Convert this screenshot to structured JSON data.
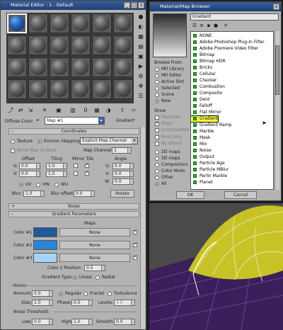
{
  "material_editor": {
    "title": "Material Editor - 1 - Default",
    "diffuse_label": "Diffuse Color:",
    "map_name": "Map #1",
    "map_type": "Gradient",
    "toolbar_zero": "0",
    "coordinates": {
      "header": "Coordinates",
      "texture": "Texture",
      "environ": "Environ",
      "mapping_label": "Mapping:",
      "mapping_value": "Explicit Map Channel",
      "show_map_on_back": "Show Map on Back",
      "map_channel_label": "Map Channel:",
      "map_channel_value": "1",
      "col_offset": "Offset",
      "col_tiling": "Tiling",
      "col_mirror_tile": "Mirror Tile",
      "col_angle": "Angle",
      "u_label": "U:",
      "v_label": "V:",
      "w_label": "W:",
      "u_offset": "0.0",
      "u_tiling": "1.0",
      "u_angle": "0.0",
      "v_offset": "0.0",
      "v_tiling": "1.0",
      "v_angle": "0.0",
      "w_angle": "0.0",
      "uv": "UV",
      "vw": "VW",
      "wu": "WU",
      "blur_label": "Blur:",
      "blur_value": "1.0",
      "blur_offset_label": "Blur offset:",
      "blur_offset_value": "0.0",
      "rotate": "Rotate"
    },
    "noise_header": "Noise",
    "gradient": {
      "header": "Gradient Parameters",
      "maps_label": "Maps",
      "color1_label": "Color #1",
      "color2_label": "Color #2",
      "color3_label": "Color #3",
      "color1": "#1f5a9a",
      "color2": "#2a86d6",
      "color3": "#a9d3f5",
      "none": "None",
      "color2_position_label": "Color 2 Position:",
      "color2_position_value": "0.5",
      "gradient_type_label": "Gradient Type:",
      "linear": "Linear",
      "radial": "Radial",
      "noise_label": "Noise:",
      "amount_label": "Amount:",
      "amount_value": "0.0",
      "regular": "Regular",
      "fractal": "Fractal",
      "turbulence": "Turbulence",
      "size_label": "Size:",
      "size_value": "1.0",
      "phase_label": "Phase:",
      "phase_value": "0.0",
      "levels_label": "Levels:",
      "levels_value": "4.0",
      "noise_threshold_label": "Noise Threshold:",
      "low_label": "Low:",
      "low_value": "0.0",
      "high_label": "High:",
      "high_value": "1.0",
      "smooth_label": "Smooth:",
      "smooth_value": "0.0"
    }
  },
  "browser": {
    "title": "Material/Map Browser",
    "search_value": "Gradient",
    "browse_from_label": "Browse From:",
    "browse_from": [
      "Mtl Library",
      "Mtl Editor",
      "Active Slot",
      "Selected",
      "Scene",
      "New"
    ],
    "show_label": "Show",
    "show_options": [
      "Materials",
      "Maps",
      "Incompatible",
      "Root Only",
      "By Object"
    ],
    "map_types": [
      "2D maps",
      "3D maps",
      "Compositors",
      "Color Mods",
      "Other",
      "All"
    ],
    "items": [
      "NONE",
      "Adobe Photoshop Plug-In Filter",
      "Adobe Premiere Video Filter",
      "Bitmap",
      "Bitmap HDR",
      "Bricks",
      "Cellular",
      "Checker",
      "Combustion",
      "Composite",
      "Dent",
      "Falloff",
      "Flat Mirror",
      "Gradient",
      "Gradient Ramp",
      "Marble",
      "Mask",
      "Mix",
      "Noise",
      "Output",
      "Particle Age",
      "Particle MBlur",
      "Perlin Marble",
      "Planet"
    ],
    "selected_item": "Gradient",
    "ok": "OK",
    "cancel": "Cancel"
  }
}
